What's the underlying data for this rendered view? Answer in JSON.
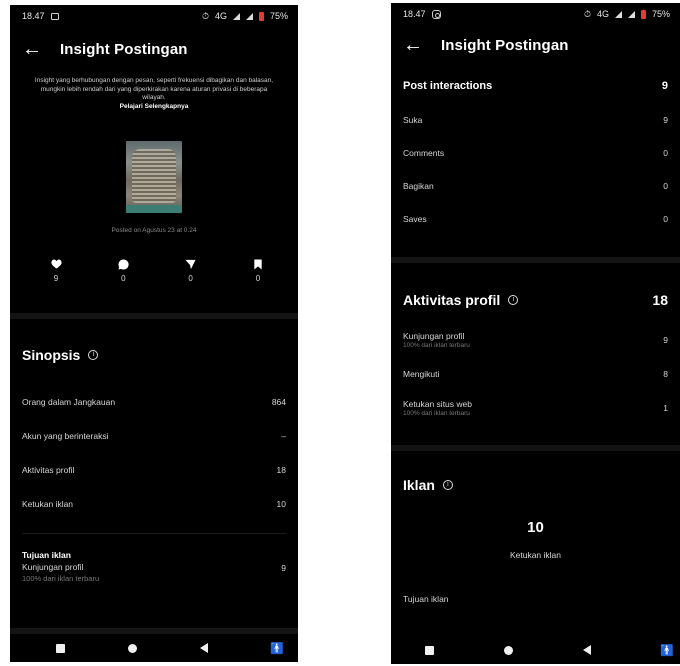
{
  "left": {
    "status": {
      "time": "18.47",
      "network": "4G",
      "battery": "75%"
    },
    "header": {
      "title": "Insight Postingan"
    },
    "notice": {
      "text": "Insight yang berhubungan dengan pesan, seperti frekuensi dibagikan dan balasan, mungkin lebih rendah dari yang diperkirakan karena aturan privasi di beberapa wilayah.",
      "link": "Pelajari Selengkapnya"
    },
    "posted_on": "Posted on Agustus 23 at 0.24",
    "stats": [
      {
        "icon": "heart-icon",
        "value": "9"
      },
      {
        "icon": "comment-icon",
        "value": "0"
      },
      {
        "icon": "share-icon",
        "value": "0"
      },
      {
        "icon": "bookmark-icon",
        "value": "0"
      }
    ],
    "sinopsis": {
      "title": "Sinopsis",
      "rows": [
        {
          "label": "Orang dalam Jangkauan",
          "value": "864"
        },
        {
          "label": "Akun yang berinteraksi",
          "value": "–"
        },
        {
          "label": "Aktivitas profil",
          "value": "18"
        },
        {
          "label": "Ketukan iklan",
          "value": "10"
        }
      ]
    },
    "tujuan": {
      "title": "Tujuan iklan",
      "label": "Kunjungan profil",
      "sub": "100% dari iklan terbaru",
      "value": "9"
    }
  },
  "right": {
    "status": {
      "time": "18.47",
      "network": "4G",
      "battery": "75%"
    },
    "header": {
      "title": "Insight Postingan"
    },
    "post_interactions": {
      "title": "Post interactions",
      "total": "9",
      "rows": [
        {
          "label": "Suka",
          "value": "9"
        },
        {
          "label": "Comments",
          "value": "0"
        },
        {
          "label": "Bagikan",
          "value": "0"
        },
        {
          "label": "Saves",
          "value": "0"
        }
      ]
    },
    "aktivitas": {
      "title": "Aktivitas profil",
      "total": "18",
      "rows": [
        {
          "label": "Kunjungan profil",
          "sub": "100% dari iklan terbaru",
          "value": "9"
        },
        {
          "label": "Mengikuti",
          "sub": "",
          "value": "8"
        },
        {
          "label": "Ketukan situs web",
          "sub": "100% dari iklan terbaru",
          "value": "1"
        }
      ]
    },
    "iklan": {
      "title": "Iklan",
      "big_value": "10",
      "big_label": "Ketukan iklan",
      "tujuan_label": "Tujuan iklan"
    }
  },
  "colors": {
    "background": "#000000",
    "text": "#ffffff",
    "muted": "#8a8a8a",
    "battery": "#e53935"
  }
}
